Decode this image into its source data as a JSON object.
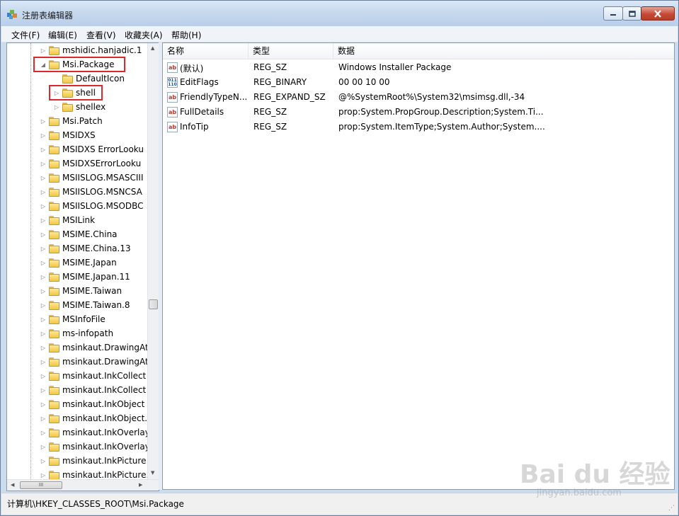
{
  "window": {
    "title": "注册表编辑器"
  },
  "menu": [
    {
      "label": "文件(F)"
    },
    {
      "label": "编辑(E)"
    },
    {
      "label": "查看(V)"
    },
    {
      "label": "收藏夹(A)"
    },
    {
      "label": "帮助(H)"
    }
  ],
  "tree": {
    "items": [
      {
        "label": "mshidic.hanjadic.1",
        "level": 0,
        "expander": "▷"
      },
      {
        "label": "Msi.Package",
        "level": 0,
        "expander": "◢",
        "highlighted": true
      },
      {
        "label": "DefaultIcon",
        "level": 1,
        "expander": ""
      },
      {
        "label": "shell",
        "level": 1,
        "expander": "▷",
        "highlighted": true
      },
      {
        "label": "shellex",
        "level": 1,
        "expander": "▷"
      },
      {
        "label": "Msi.Patch",
        "level": 0,
        "expander": "▷"
      },
      {
        "label": "MSIDXS",
        "level": 0,
        "expander": "▷"
      },
      {
        "label": "MSIDXS ErrorLooku",
        "level": 0,
        "expander": "▷"
      },
      {
        "label": "MSIDXSErrorLooku",
        "level": 0,
        "expander": "▷"
      },
      {
        "label": "MSIISLOG.MSASCIII",
        "level": 0,
        "expander": "▷"
      },
      {
        "label": "MSIISLOG.MSNCSA",
        "level": 0,
        "expander": "▷"
      },
      {
        "label": "MSIISLOG.MSODBC",
        "level": 0,
        "expander": "▷"
      },
      {
        "label": "MSILink",
        "level": 0,
        "expander": "▷"
      },
      {
        "label": "MSIME.China",
        "level": 0,
        "expander": "▷"
      },
      {
        "label": "MSIME.China.13",
        "level": 0,
        "expander": "▷"
      },
      {
        "label": "MSIME.Japan",
        "level": 0,
        "expander": "▷"
      },
      {
        "label": "MSIME.Japan.11",
        "level": 0,
        "expander": "▷"
      },
      {
        "label": "MSIME.Taiwan",
        "level": 0,
        "expander": "▷"
      },
      {
        "label": "MSIME.Taiwan.8",
        "level": 0,
        "expander": "▷"
      },
      {
        "label": "MSInfoFile",
        "level": 0,
        "expander": "▷"
      },
      {
        "label": "ms-infopath",
        "level": 0,
        "expander": "▷"
      },
      {
        "label": "msinkaut.DrawingAt",
        "level": 0,
        "expander": "▷"
      },
      {
        "label": "msinkaut.DrawingAt",
        "level": 0,
        "expander": "▷"
      },
      {
        "label": "msinkaut.InkCollect",
        "level": 0,
        "expander": "▷"
      },
      {
        "label": "msinkaut.InkCollect",
        "level": 0,
        "expander": "▷"
      },
      {
        "label": "msinkaut.InkObject",
        "level": 0,
        "expander": "▷"
      },
      {
        "label": "msinkaut.InkObject.",
        "level": 0,
        "expander": "▷"
      },
      {
        "label": "msinkaut.InkOverlay",
        "level": 0,
        "expander": "▷"
      },
      {
        "label": "msinkaut.InkOverlay",
        "level": 0,
        "expander": "▷"
      },
      {
        "label": "msinkaut.InkPicture",
        "level": 0,
        "expander": "▷"
      },
      {
        "label": "msinkaut.InkPicture.",
        "level": 0,
        "expander": "▷"
      }
    ],
    "hscroll_thumb": "III"
  },
  "list": {
    "columns": [
      "名称",
      "类型",
      "数据"
    ],
    "rows": [
      {
        "icon": "ab",
        "name": "(默认)",
        "type": "REG_SZ",
        "data": "Windows Installer Package"
      },
      {
        "icon": "bin",
        "name": "EditFlags",
        "type": "REG_BINARY",
        "data": "00 00 10 00"
      },
      {
        "icon": "ab",
        "name": "FriendlyTypeN...",
        "type": "REG_EXPAND_SZ",
        "data": "@%SystemRoot%\\System32\\msimsg.dll,-34"
      },
      {
        "icon": "ab",
        "name": "FullDetails",
        "type": "REG_SZ",
        "data": "prop:System.PropGroup.Description;System.Ti..."
      },
      {
        "icon": "ab",
        "name": "InfoTip",
        "type": "REG_SZ",
        "data": "prop:System.ItemType;System.Author;System...."
      }
    ]
  },
  "status": {
    "path": "计算机\\HKEY_CLASSES_ROOT\\Msi.Package"
  },
  "watermark": {
    "brand": "Bai du 经验",
    "url": "jingyan.baidu.com"
  },
  "colors": {
    "highlight": "#e0262d",
    "folder": "#f1c649"
  }
}
